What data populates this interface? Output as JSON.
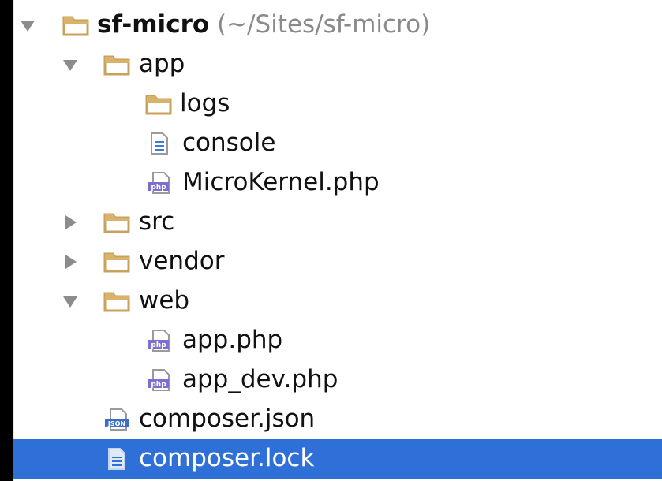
{
  "tree": {
    "project_name": "sf-micro",
    "project_path": "(~/Sites/sf-micro)",
    "items": [
      {
        "label": "app",
        "type": "folder"
      },
      {
        "label": "logs",
        "type": "folder"
      },
      {
        "label": "console",
        "type": "text-file"
      },
      {
        "label": "MicroKernel.php",
        "type": "php-file"
      },
      {
        "label": "src",
        "type": "folder"
      },
      {
        "label": "vendor",
        "type": "folder"
      },
      {
        "label": "web",
        "type": "folder"
      },
      {
        "label": "app.php",
        "type": "php-file"
      },
      {
        "label": "app_dev.php",
        "type": "php-file"
      },
      {
        "label": "composer.json",
        "type": "json-file"
      },
      {
        "label": "composer.lock",
        "type": "text-file",
        "selected": true
      }
    ]
  },
  "colors": {
    "selection": "#2f6fd8",
    "folder_fill": "#d9b36b",
    "php_badge": "#7b6fd3",
    "background": "#ffffff"
  }
}
